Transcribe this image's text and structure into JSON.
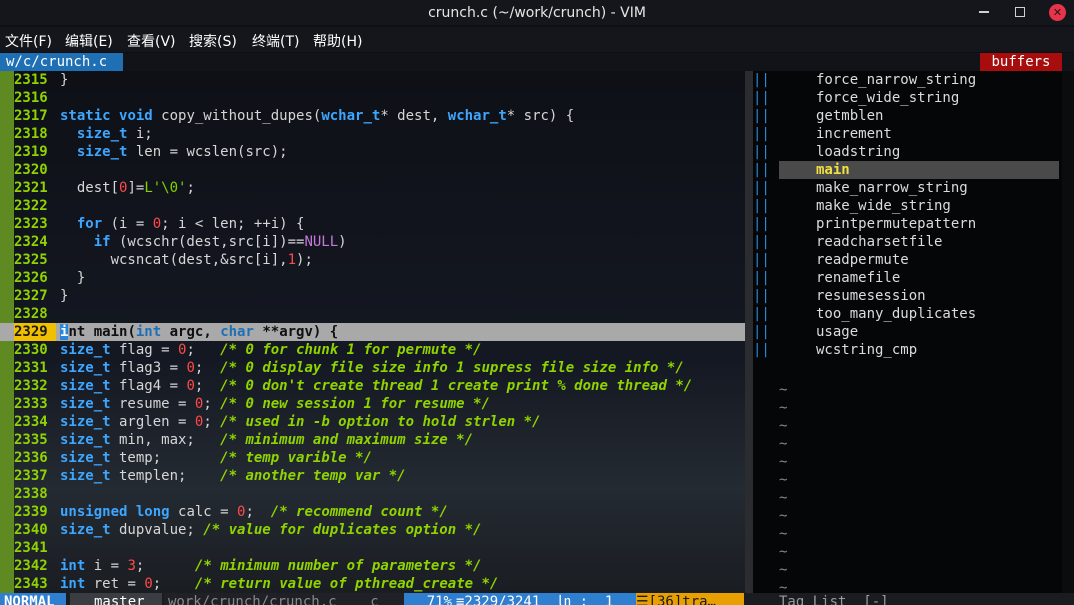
{
  "window": {
    "title": "crunch.c (~/work/crunch) - VIM"
  },
  "menu": [
    "文件(F)",
    "编辑(E)",
    "查看(V)",
    "搜索(S)",
    "终端(T)",
    "帮助(H)"
  ],
  "tabline": {
    "current_tab": "w/c/crunch.c",
    "buffers_label": "buffers"
  },
  "editor": {
    "current_line": "2329",
    "lines": [
      {
        "n": "2315",
        "t": "}"
      },
      {
        "n": "2316",
        "t": ""
      },
      {
        "n": "2317",
        "t": "static void copy_without_dupes(wchar_t* dest, wchar_t* src) {"
      },
      {
        "n": "2318",
        "t": "  size_t i;"
      },
      {
        "n": "2319",
        "t": "  size_t len = wcslen(src);"
      },
      {
        "n": "2320",
        "t": ""
      },
      {
        "n": "2321",
        "t": "  dest[0]=L'\\0';"
      },
      {
        "n": "2322",
        "t": ""
      },
      {
        "n": "2323",
        "t": "  for (i = 0; i < len; ++i) {"
      },
      {
        "n": "2324",
        "t": "    if (wcschr(dest,src[i])==NULL)"
      },
      {
        "n": "2325",
        "t": "      wcsncat(dest,&src[i],1);"
      },
      {
        "n": "2326",
        "t": "  }"
      },
      {
        "n": "2327",
        "t": "}"
      },
      {
        "n": "2328",
        "t": ""
      },
      {
        "n": "2329",
        "t": "int main(int argc, char **argv) {"
      },
      {
        "n": "2330",
        "t": "size_t flag = 0;   /* 0 for chunk 1 for permute */"
      },
      {
        "n": "2331",
        "t": "size_t flag3 = 0;  /* 0 display file size info 1 supress file size info */"
      },
      {
        "n": "2332",
        "t": "size_t flag4 = 0;  /* 0 don't create thread 1 create print % done thread */"
      },
      {
        "n": "2333",
        "t": "size_t resume = 0; /* 0 new session 1 for resume */"
      },
      {
        "n": "2334",
        "t": "size_t arglen = 0; /* used in -b option to hold strlen */"
      },
      {
        "n": "2335",
        "t": "size_t min, max;   /* minimum and maximum size */"
      },
      {
        "n": "2336",
        "t": "size_t temp;       /* temp varible */"
      },
      {
        "n": "2337",
        "t": "size_t templen;    /* another temp var */"
      },
      {
        "n": "2338",
        "t": ""
      },
      {
        "n": "2339",
        "t": "unsigned long calc = 0;  /* recommend count */"
      },
      {
        "n": "2340",
        "t": "size_t dupvalue; /* value for duplicates option */"
      },
      {
        "n": "2341",
        "t": ""
      },
      {
        "n": "2342",
        "t": "int i = 3;      /* minimum number of parameters */"
      },
      {
        "n": "2343",
        "t": "int ret = 0;    /* return value of pthread_create */"
      }
    ]
  },
  "taglist": {
    "selected": "main",
    "tags": [
      "force_narrow_string",
      "force_wide_string",
      "getmblen",
      "increment",
      "loadstring",
      "main",
      "make_narrow_string",
      "make_wide_string",
      "printpermutepattern",
      "readcharsetfile",
      "readpermute",
      "renamefile",
      "resumesession",
      "too_many_duplicates",
      "usage",
      "wcstring_cmp"
    ],
    "empty_marker": "~",
    "title": "Tag List  [-]"
  },
  "statusline": {
    "mode": "NORMAL",
    "branch": "master",
    "file": "work/crunch/crunch.c    c",
    "percent": "71%",
    "position": "≡2329/3241  ㏑ :  1",
    "warning": "☰[36]tra…"
  },
  "colors": {
    "line_number": "#8fd400",
    "keyword": "#3da6ff",
    "number": "#ff4a4a",
    "comment": "#8fd400",
    "current_line_bg": "#a9a9a9",
    "cursor": "#2a86d8",
    "tab_current_bg": "#1f6fb5",
    "buffers_bg": "#a80d0d",
    "taglist_selected_fg": "#f0e040",
    "mode_bg": "#2f7fd0"
  }
}
